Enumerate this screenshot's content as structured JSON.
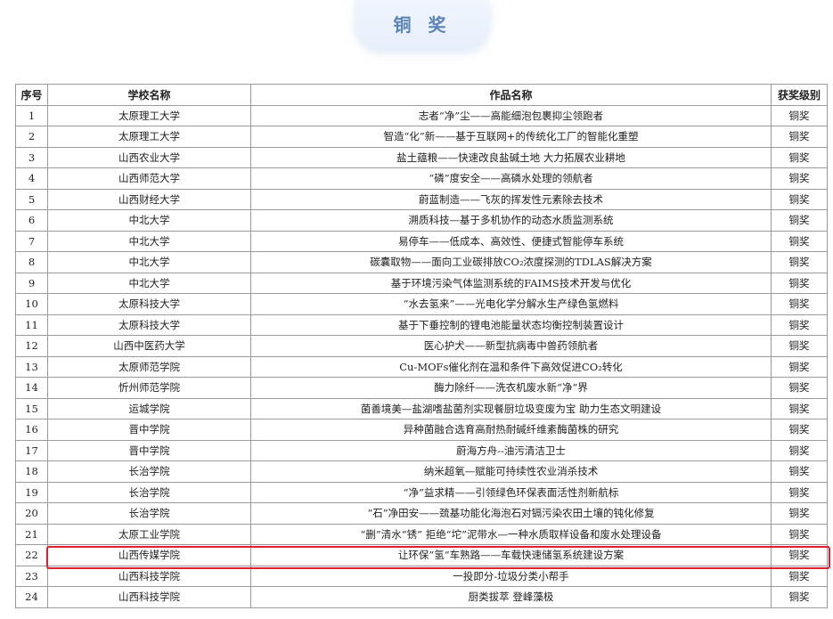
{
  "heading": "铜 奖",
  "table": {
    "headers": [
      "序号",
      "学校名称",
      "作品名称",
      "获奖级别"
    ],
    "rows": [
      [
        "1",
        "太原理工大学",
        "志者“净”尘——高能细泡包裹抑尘领跑者",
        "铜奖"
      ],
      [
        "2",
        "太原理工大学",
        "智造“化”新——基于互联网+的传统化工厂的智能化重塑",
        "铜奖"
      ],
      [
        "3",
        "山西农业大学",
        "盐土蕴粮——快速改良盐碱土地  大力拓展农业耕地",
        "铜奖"
      ],
      [
        "4",
        "山西师范大学",
        "“磷”度安全——高磷水处理的领航者",
        "铜奖"
      ],
      [
        "5",
        "山西财经大学",
        "蔚蓝制造——飞灰的挥发性元素除去技术",
        "铜奖"
      ],
      [
        "6",
        "中北大学",
        "溯质科技—基于多机协作的动态水质监测系统",
        "铜奖"
      ],
      [
        "7",
        "中北大学",
        "易停车——低成本、高效性、便捷式智能停车系统",
        "铜奖"
      ],
      [
        "8",
        "中北大学",
        "碳囊取物——面向工业碳排放CO₂浓度探测的TDLAS解决方案",
        "铜奖"
      ],
      [
        "9",
        "中北大学",
        "基于环境污染气体监测系统的FAIMS技术开发与优化",
        "铜奖"
      ],
      [
        "10",
        "太原科技大学",
        "“水去氢来”——光电化学分解水生产绿色氢燃料",
        "铜奖"
      ],
      [
        "11",
        "太原科技大学",
        "基于下垂控制的锂电池能量状态均衡控制装置设计",
        "铜奖"
      ],
      [
        "12",
        "山西中医药大学",
        "医心护犬——新型抗病毒中兽药领航者",
        "铜奖"
      ],
      [
        "13",
        "太原师范学院",
        "Cu-MOFs催化剂在温和条件下高效促进CO₂转化",
        "铜奖"
      ],
      [
        "14",
        "忻州师范学院",
        "酶力除纤——洗衣机废水新“净”界",
        "铜奖"
      ],
      [
        "15",
        "运城学院",
        "菌善境美—盐湖嗜盐菌剂实现餐厨垃圾变废为宝 助力生态文明建设",
        "铜奖"
      ],
      [
        "16",
        "晋中学院",
        "异种菌融合选育高耐热耐碱纤维素酶菌株的研究",
        "铜奖"
      ],
      [
        "17",
        "晋中学院",
        "蔚海方舟--油污清洁卫士",
        "铜奖"
      ],
      [
        "18",
        "长治学院",
        "纳米超氧—赋能可持续性农业消杀技术",
        "铜奖"
      ],
      [
        "19",
        "长治学院",
        "“净”益求精——引领绿色环保表面活性剂新航标",
        "铜奖"
      ],
      [
        "20",
        "长治学院",
        "“石”净田安——巯基功能化海泡石对镉污染农田土壤的钝化修复",
        "铜奖"
      ],
      [
        "21",
        "太原工业学院",
        "“删”清水“锈” 拒绝“坨”泥带水—一种水质取样设备和废水处理设备",
        "铜奖"
      ],
      [
        "22",
        "山西传媒学院",
        "让环保”氢“车熟路——车载快速储氢系统建设方案",
        "铜奖"
      ],
      [
        "23",
        "山西科技学院",
        "一投即分-垃圾分类小帮手",
        "铜奖"
      ],
      [
        "24",
        "山西科技学院",
        "厨类拔萃 登峰藻极",
        "铜奖"
      ]
    ]
  }
}
